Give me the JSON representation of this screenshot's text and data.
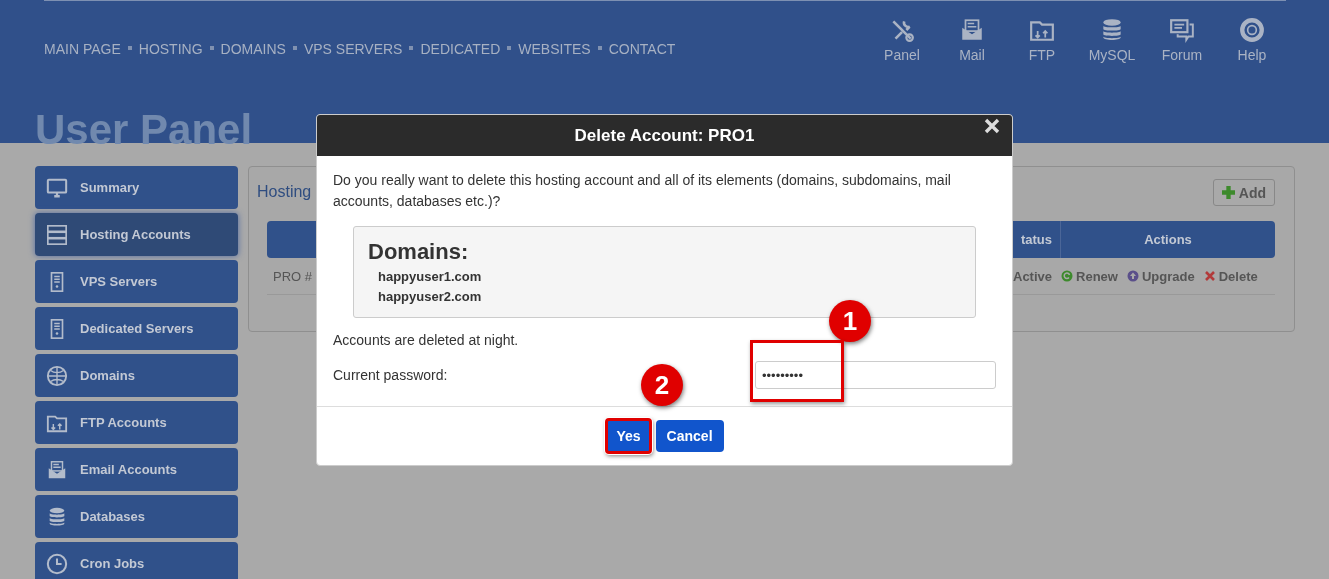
{
  "header": {
    "nav": [
      "MAIN PAGE",
      "HOSTING",
      "DOMAINS",
      "VPS SERVERS",
      "DEDICATED",
      "WEBSITES",
      "CONTACT"
    ],
    "tools": [
      {
        "label": "Panel",
        "kind": "tools"
      },
      {
        "label": "Mail",
        "kind": "mail"
      },
      {
        "label": "FTP",
        "kind": "folder"
      },
      {
        "label": "MySQL",
        "kind": "database"
      },
      {
        "label": "Forum",
        "kind": "chat"
      },
      {
        "label": "Help",
        "kind": "lifebuoy"
      }
    ]
  },
  "page_title": "User Panel",
  "sidebar": {
    "items": [
      {
        "label": "Summary",
        "kind": "monitor",
        "selected": false
      },
      {
        "label": "Hosting Accounts",
        "kind": "server",
        "selected": true
      },
      {
        "label": "VPS Servers",
        "kind": "tower",
        "selected": false
      },
      {
        "label": "Dedicated Servers",
        "kind": "tower",
        "selected": false
      },
      {
        "label": "Domains",
        "kind": "globe",
        "selected": false
      },
      {
        "label": "FTP Accounts",
        "kind": "folder",
        "selected": false
      },
      {
        "label": "Email Accounts",
        "kind": "mail",
        "selected": false
      },
      {
        "label": "Databases",
        "kind": "database",
        "selected": false
      },
      {
        "label": "Cron Jobs",
        "kind": "clock",
        "selected": false
      }
    ]
  },
  "panel": {
    "title": "Hosting",
    "add_button": "Add",
    "columns": [
      "tatus",
      "Actions"
    ],
    "rows": [
      {
        "column_1": "PRO #",
        "status": "Active",
        "actions": [
          {
            "label": "Renew",
            "kind": "renew"
          },
          {
            "label": "Upgrade",
            "kind": "upgrade"
          },
          {
            "label": "Delete",
            "kind": "delete"
          }
        ]
      }
    ]
  },
  "dialog": {
    "title": "Delete Account: PRO1",
    "message": "Do you really want to delete this hosting account and all of its elements (domains, subdomains, mail accounts, databases etc.)?",
    "domains_heading": "Domains:",
    "domains": [
      "happyuser1.com",
      "happyuser2.com"
    ],
    "note": "Accounts are deleted at night.",
    "password_label": "Current password:",
    "password_value": "•••••••••",
    "buttons": [
      {
        "label": "Yes",
        "highlighted": true
      },
      {
        "label": "Cancel",
        "highlighted": false
      }
    ],
    "annotations": [
      {
        "label": "1",
        "kind": "field"
      },
      {
        "label": "2",
        "kind": "button"
      }
    ]
  }
}
